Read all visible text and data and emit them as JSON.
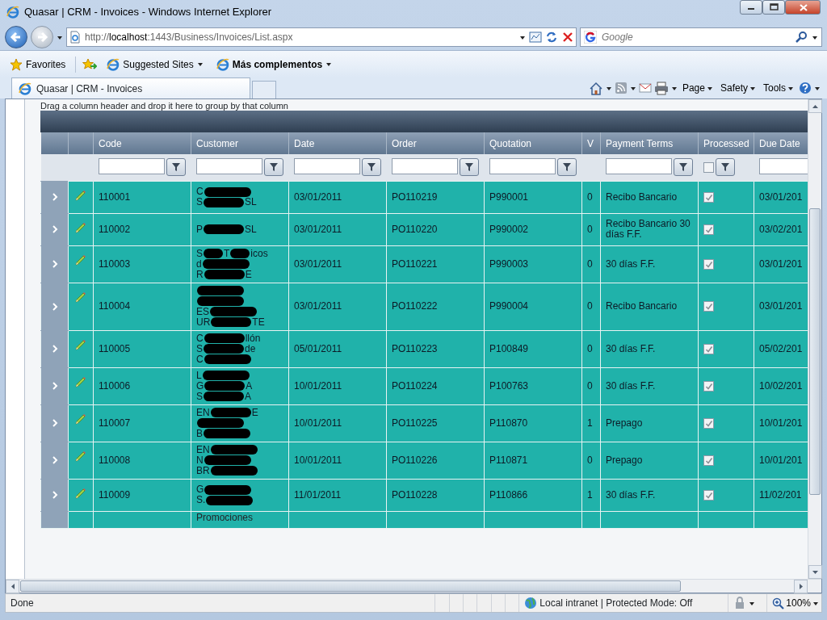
{
  "window": {
    "title": "Quasar | CRM - Invoices - Windows Internet Explorer"
  },
  "address_bar": {
    "url": "http://**localhost**:1443/Business/Invoices/List.aspx"
  },
  "search": {
    "placeholder": "Google"
  },
  "favorites_bar": {
    "items": [
      {
        "label": "Favorites",
        "bold": false
      },
      {
        "label": "Suggested Sites",
        "bold": false
      },
      {
        "label": "Más complementos",
        "bold": true
      }
    ]
  },
  "tabs": [
    {
      "label": "Quasar | CRM - Invoices",
      "selected": true
    }
  ],
  "command_bar": {
    "menus": [
      "Page",
      "Safety",
      "Tools"
    ]
  },
  "grid": {
    "group_hint": "Drag a column header and drop it here to group by that column",
    "columns": [
      {
        "label": "Code",
        "kind": "text"
      },
      {
        "label": "Customer",
        "kind": "text"
      },
      {
        "label": "Date",
        "kind": "text"
      },
      {
        "label": "Order",
        "kind": "text"
      },
      {
        "label": "Quotation",
        "kind": "text"
      },
      {
        "label": "V",
        "kind": "plain"
      },
      {
        "label": "Payment Terms",
        "kind": "text"
      },
      {
        "label": "Processed",
        "kind": "checkbox",
        "checked": false
      },
      {
        "label": "Due Date",
        "kind": "text"
      }
    ],
    "rows": [
      {
        "code": "110001",
        "customer": [
          [
            "C"
          ],
          [
            "S",
            "SL"
          ]
        ],
        "date": "03/01/2011",
        "order": "PO110219",
        "quotation": "P990001",
        "v": "0",
        "payment_terms": "Recibo Bancario",
        "processed": true,
        "due_date": "03/01/201"
      },
      {
        "code": "110002",
        "customer": [
          [
            "P",
            "SL"
          ]
        ],
        "date": "03/01/2011",
        "order": "PO110220",
        "quotation": "P990002",
        "v": "0",
        "payment_terms": "Recibo Bancario 30 días F.F.",
        "processed": true,
        "due_date": "03/02/201"
      },
      {
        "code": "110003",
        "customer": [
          [
            "S",
            "T",
            "icos"
          ],
          [
            "d"
          ],
          [
            "R",
            "E"
          ]
        ],
        "date": "03/01/2011",
        "order": "PO110221",
        "quotation": "P990003",
        "v": "0",
        "payment_terms": "30 días F.F.",
        "processed": true,
        "due_date": "03/01/201"
      },
      {
        "code": "110004",
        "customer": [
          {
            "kind": "covered"
          },
          {
            "kind": "covered"
          },
          [
            "ES"
          ],
          [
            "UR",
            "TE"
          ]
        ],
        "date": "03/01/2011",
        "order": "PO110222",
        "quotation": "P990004",
        "v": "0",
        "payment_terms": "Recibo Bancario",
        "processed": true,
        "due_date": "03/01/201"
      },
      {
        "code": "110005",
        "customer": [
          [
            "C",
            "llón"
          ],
          [
            "S",
            "de"
          ],
          [
            "C"
          ]
        ],
        "date": "05/01/2011",
        "order": "PO110223",
        "quotation": "P100849",
        "v": "0",
        "payment_terms": "30 días F.F.",
        "processed": true,
        "due_date": "05/02/201"
      },
      {
        "code": "110006",
        "customer": [
          [
            "L"
          ],
          [
            "G",
            "A"
          ],
          [
            "S",
            "A"
          ]
        ],
        "date": "10/01/2011",
        "order": "PO110224",
        "quotation": "P100763",
        "v": "0",
        "payment_terms": "30 días F.F.",
        "processed": true,
        "due_date": "10/02/201"
      },
      {
        "code": "110007",
        "customer": [
          [
            "EN",
            "E"
          ],
          {
            "kind": "covered"
          },
          [
            "B"
          ]
        ],
        "date": "10/01/2011",
        "order": "PO110225",
        "quotation": "P110870",
        "v": "1",
        "payment_terms": "Prepago",
        "processed": true,
        "due_date": "10/01/201"
      },
      {
        "code": "110008",
        "customer": [
          [
            "EN"
          ],
          [
            "N"
          ],
          [
            "BR"
          ]
        ],
        "date": "10/01/2011",
        "order": "PO110226",
        "quotation": "P110871",
        "v": "0",
        "payment_terms": "Prepago",
        "processed": true,
        "due_date": "10/01/201"
      },
      {
        "code": "110009",
        "customer": [
          [
            "G"
          ],
          [
            "S."
          ]
        ],
        "date": "11/01/2011",
        "order": "PO110228",
        "quotation": "P110866",
        "v": "1",
        "payment_terms": "30 días F.F.",
        "processed": true,
        "due_date": "11/02/201"
      }
    ],
    "partial_row": {
      "customer": "Promociones"
    }
  },
  "status_bar": {
    "text": "Done",
    "zone": "Local intranet | Protected Mode: Off",
    "zoom": "100%"
  }
}
